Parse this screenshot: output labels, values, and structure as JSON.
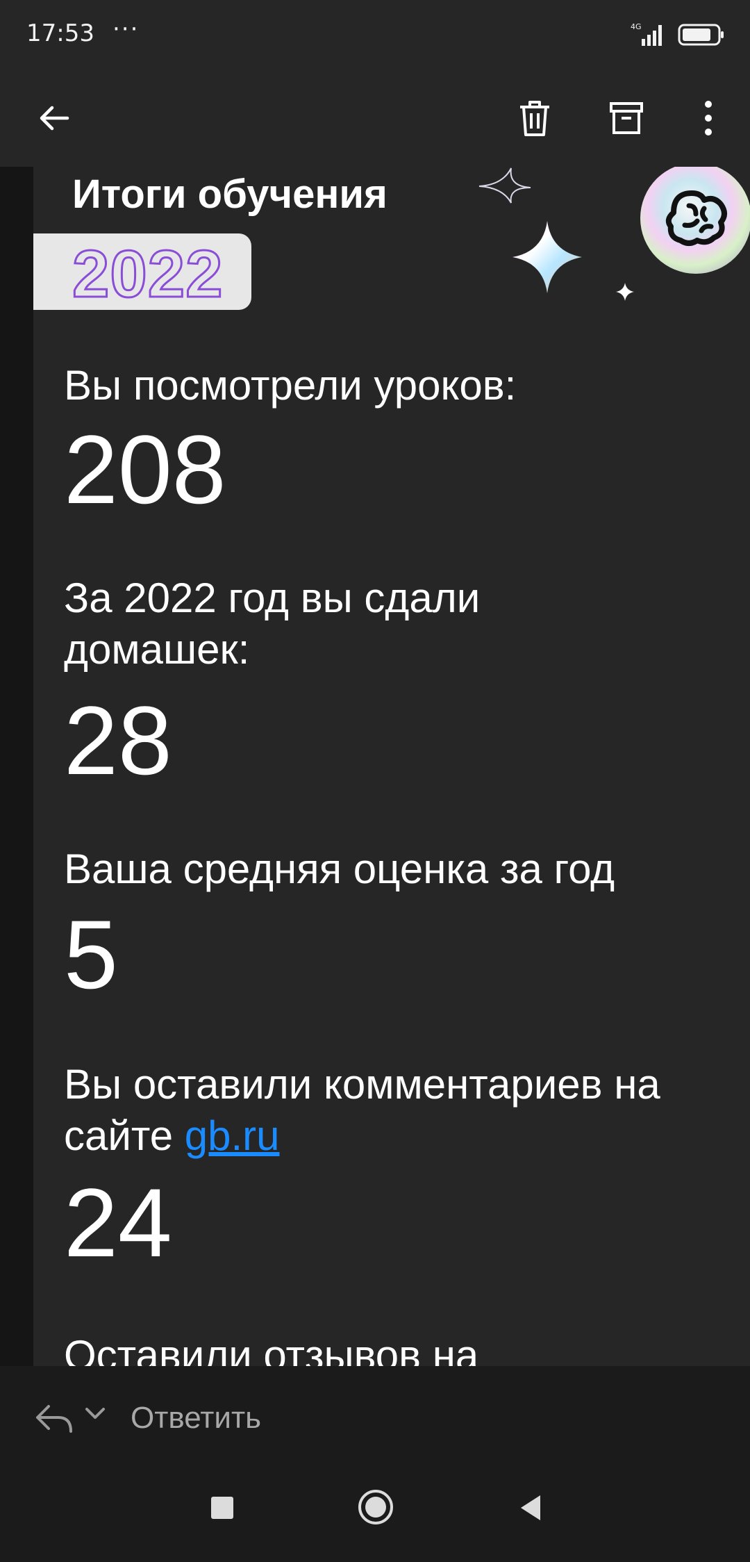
{
  "status_bar": {
    "time": "17:53",
    "dots": "···",
    "network": "4G"
  },
  "toolbar": {
    "back_icon": "arrow-left-icon",
    "delete_icon": "trash-icon",
    "archive_icon": "archive-icon",
    "more_icon": "more-vertical-icon"
  },
  "email": {
    "title": "Итоги обучения",
    "year": "2022",
    "stats": [
      {
        "label": "Вы посмотрели уроков:",
        "value": "208"
      },
      {
        "label": "За 2022 год вы сдали домашек:",
        "value": "28"
      },
      {
        "label": "Ваша средняя оценка за год",
        "value": "5"
      },
      {
        "label_prefix": "Вы оставили комментариев на сайте",
        "link": "gb.ru",
        "value": "24"
      },
      {
        "label": "Оставили отзывов на"
      }
    ]
  },
  "reply_bar": {
    "reply_label": "Ответить"
  },
  "colors": {
    "background": "#262626",
    "link": "#1a8cff",
    "year_outline": "#8a4dd6"
  }
}
